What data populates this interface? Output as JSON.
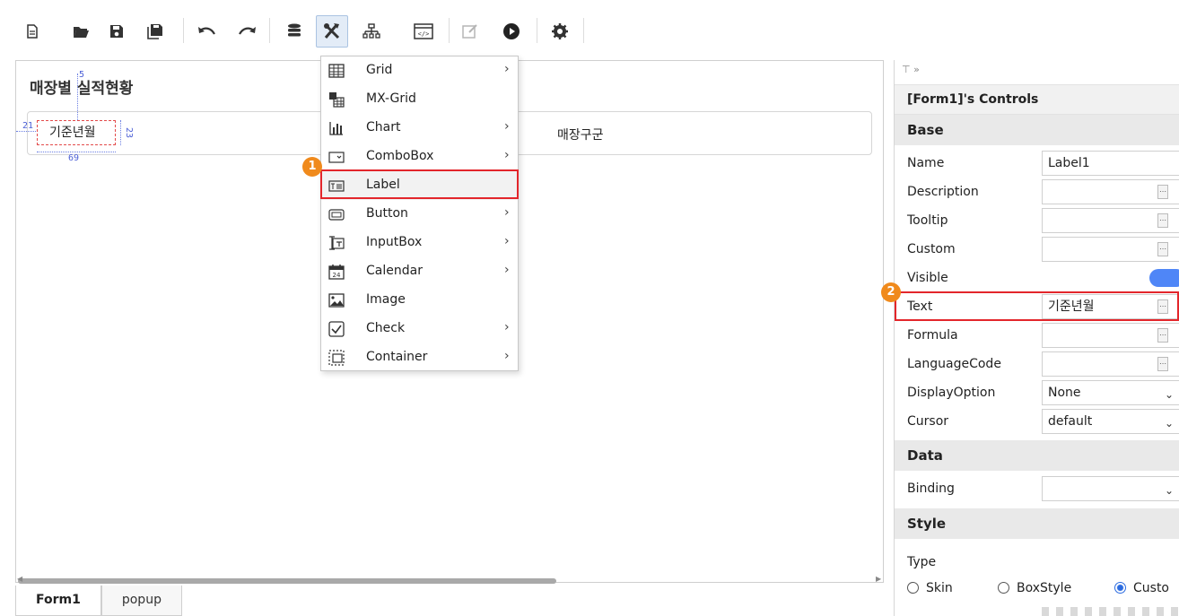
{
  "toolbar": {
    "icons": [
      "new-file-icon",
      "open-folder-icon",
      "save-icon",
      "save-all-icon",
      "undo-icon",
      "redo-icon",
      "database-icon",
      "tools-icon",
      "hierarchy-icon",
      "code-view-icon",
      "edit-icon",
      "run-icon",
      "settings-icon"
    ]
  },
  "form": {
    "title": "매장별 실적현황",
    "label1_text": "기준년월",
    "column_text": "매장구군",
    "guides": {
      "top": "5",
      "left": "21",
      "height": "23",
      "width": "69"
    }
  },
  "tabs": [
    {
      "label": "Form1"
    },
    {
      "label": "popup"
    }
  ],
  "menu": {
    "items": [
      {
        "label": "Grid",
        "has_submenu": true,
        "icon": "grid-icon"
      },
      {
        "label": "MX-Grid",
        "has_submenu": false,
        "icon": "mx-grid-icon"
      },
      {
        "label": "Chart",
        "has_submenu": true,
        "icon": "chart-icon"
      },
      {
        "label": "ComboBox",
        "has_submenu": true,
        "icon": "combobox-icon"
      },
      {
        "label": "Label",
        "has_submenu": false,
        "icon": "label-icon"
      },
      {
        "label": "Button",
        "has_submenu": true,
        "icon": "button-icon"
      },
      {
        "label": "InputBox",
        "has_submenu": true,
        "icon": "inputbox-icon"
      },
      {
        "label": "Calendar",
        "has_submenu": true,
        "icon": "calendar-icon"
      },
      {
        "label": "Image",
        "has_submenu": false,
        "icon": "image-icon"
      },
      {
        "label": "Check",
        "has_submenu": true,
        "icon": "check-icon"
      },
      {
        "label": "Container",
        "has_submenu": true,
        "icon": "container-icon"
      }
    ],
    "arrow": "›"
  },
  "callouts": {
    "one": "1",
    "two": "2"
  },
  "panel": {
    "pins": "⊤ »",
    "header": "[Form1]'s Controls",
    "sections": {
      "base": "Base",
      "data": "Data",
      "style": "Style"
    },
    "props": {
      "name": {
        "label": "Name",
        "value": "Label1"
      },
      "description": {
        "label": "Description",
        "value": ""
      },
      "tooltip": {
        "label": "Tooltip",
        "value": ""
      },
      "custom": {
        "label": "Custom",
        "value": ""
      },
      "visible": {
        "label": "Visible",
        "value": true
      },
      "text": {
        "label": "Text",
        "value": "기준년월"
      },
      "formula": {
        "label": "Formula",
        "value": ""
      },
      "languagecode": {
        "label": "LanguageCode",
        "value": ""
      },
      "displayoption": {
        "label": "DisplayOption",
        "value": "None"
      },
      "cursor": {
        "label": "Cursor",
        "value": "default"
      },
      "binding": {
        "label": "Binding",
        "value": ""
      },
      "type": {
        "label": "Type"
      }
    },
    "type_options": [
      {
        "label": "Skin",
        "checked": false
      },
      {
        "label": "BoxStyle",
        "checked": false
      },
      {
        "label": "Custo",
        "checked": true
      }
    ]
  },
  "colors": {
    "accent": "#4f86f7",
    "highlight": "#e3262b",
    "badge": "#f08a1c"
  }
}
